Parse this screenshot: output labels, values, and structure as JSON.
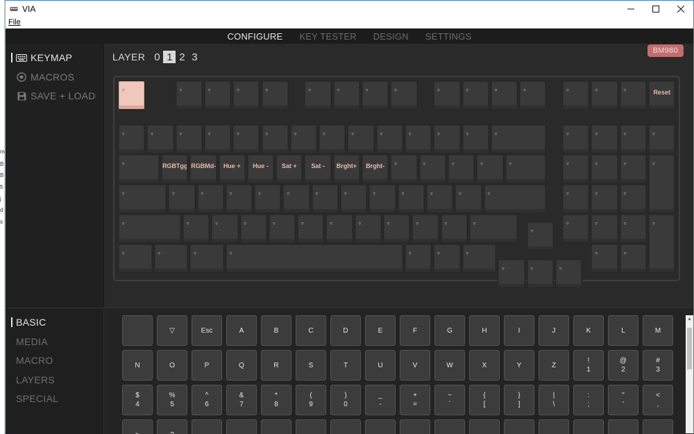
{
  "window": {
    "title": "VIA",
    "menu_file": "File"
  },
  "desktop_strip": [
    "m",
    "B",
    "B",
    "fi",
    "j",
    "d",
    "s"
  ],
  "nav": {
    "tabs": [
      {
        "label": "CONFIGURE",
        "active": true
      },
      {
        "label": "KEY TESTER",
        "active": false
      },
      {
        "label": "DESIGN",
        "active": false
      },
      {
        "label": "SETTINGS",
        "active": false
      }
    ]
  },
  "sidebar": {
    "items": [
      {
        "label": "KEYMAP",
        "icon": "keyboard-icon",
        "active": true
      },
      {
        "label": "MACROS",
        "icon": "record-icon",
        "active": false
      },
      {
        "label": "SAVE + LOAD",
        "icon": "floppy-icon",
        "active": false
      }
    ]
  },
  "layers": {
    "label": "LAYER",
    "options": [
      "0",
      "1",
      "2",
      "3"
    ],
    "selected": "1"
  },
  "device_badge": "BM980",
  "keyboard": {
    "rows": [
      [
        "▿",
        "",
        "▿",
        "▿",
        "▿",
        "▿",
        "",
        "▿",
        "▿",
        "▿",
        "▿",
        "",
        "▿",
        "▿",
        "▿",
        "▿",
        "",
        "▿",
        "▿",
        "▿",
        "Reset"
      ],
      [
        "▿",
        "▿",
        "▿",
        "▿",
        "▿",
        "▿",
        "▿",
        "▿",
        "▿",
        "▿",
        "▿",
        "▿",
        "▿",
        "▿",
        "▿",
        "▿",
        "▿",
        "▿"
      ],
      [
        "▿",
        "RGBTgg",
        "RGBMd-",
        "Hue +",
        "Hue -",
        "Sat +",
        "Sat -",
        "Brght+",
        "Brght-",
        "▿",
        "▿",
        "▿",
        "▿",
        "▿",
        "▿",
        "▿",
        "▿",
        "▿"
      ],
      [
        "▿",
        "▿",
        "▿",
        "▿",
        "▿",
        "▿",
        "▿",
        "▿",
        "▿",
        "▿",
        "▿",
        "▿",
        "▿",
        "▿",
        "▿",
        "▿"
      ],
      [
        "▿",
        "▿",
        "▿",
        "▿",
        "▿",
        "▿",
        "▿",
        "▿",
        "▿",
        "▿",
        "▿",
        "▿",
        "▿",
        "▿",
        "▿",
        "▿",
        "▿"
      ],
      [
        "▿",
        "▿",
        "▿",
        "▿",
        "▿",
        "▿",
        "▿",
        "▿",
        "▿",
        "▿",
        "▿",
        "▿",
        "▿"
      ]
    ]
  },
  "categories": [
    {
      "label": "BASIC",
      "active": true
    },
    {
      "label": "MEDIA",
      "active": false
    },
    {
      "label": "MACRO",
      "active": false
    },
    {
      "label": "LAYERS",
      "active": false
    },
    {
      "label": "SPECIAL",
      "active": false
    }
  ],
  "palette": [
    [
      "",
      "▽",
      "Esc",
      "A",
      "B",
      "C",
      "D",
      "E",
      "F",
      "G",
      "H",
      "I",
      "J",
      "K",
      "L",
      "M"
    ],
    [
      "N",
      "O",
      "P",
      "Q",
      "R",
      "S",
      "T",
      "U",
      "V",
      "W",
      "X",
      "Y",
      "Z",
      "!\n1",
      "@\n2",
      "#\n3"
    ],
    [
      "$\n4",
      "%\n5",
      "^\n6",
      "&\n7",
      "*\n8",
      "(\n9",
      ")\n0",
      "_\n-",
      "+\n=",
      "~\n`",
      "{\n[",
      "}\n]",
      "|\n\\",
      ":\n;",
      "\"\n'",
      "<\n,"
    ],
    [
      ">",
      "?",
      "",
      "",
      "",
      "",
      "",
      "",
      "",
      "",
      "",
      "",
      "",
      "",
      "",
      ""
    ]
  ],
  "colors": {
    "app_bg": "#232323",
    "selected_key": "#f0c7bb",
    "legend_accent": "#e8b9aa",
    "badge": "#c46d6d"
  }
}
